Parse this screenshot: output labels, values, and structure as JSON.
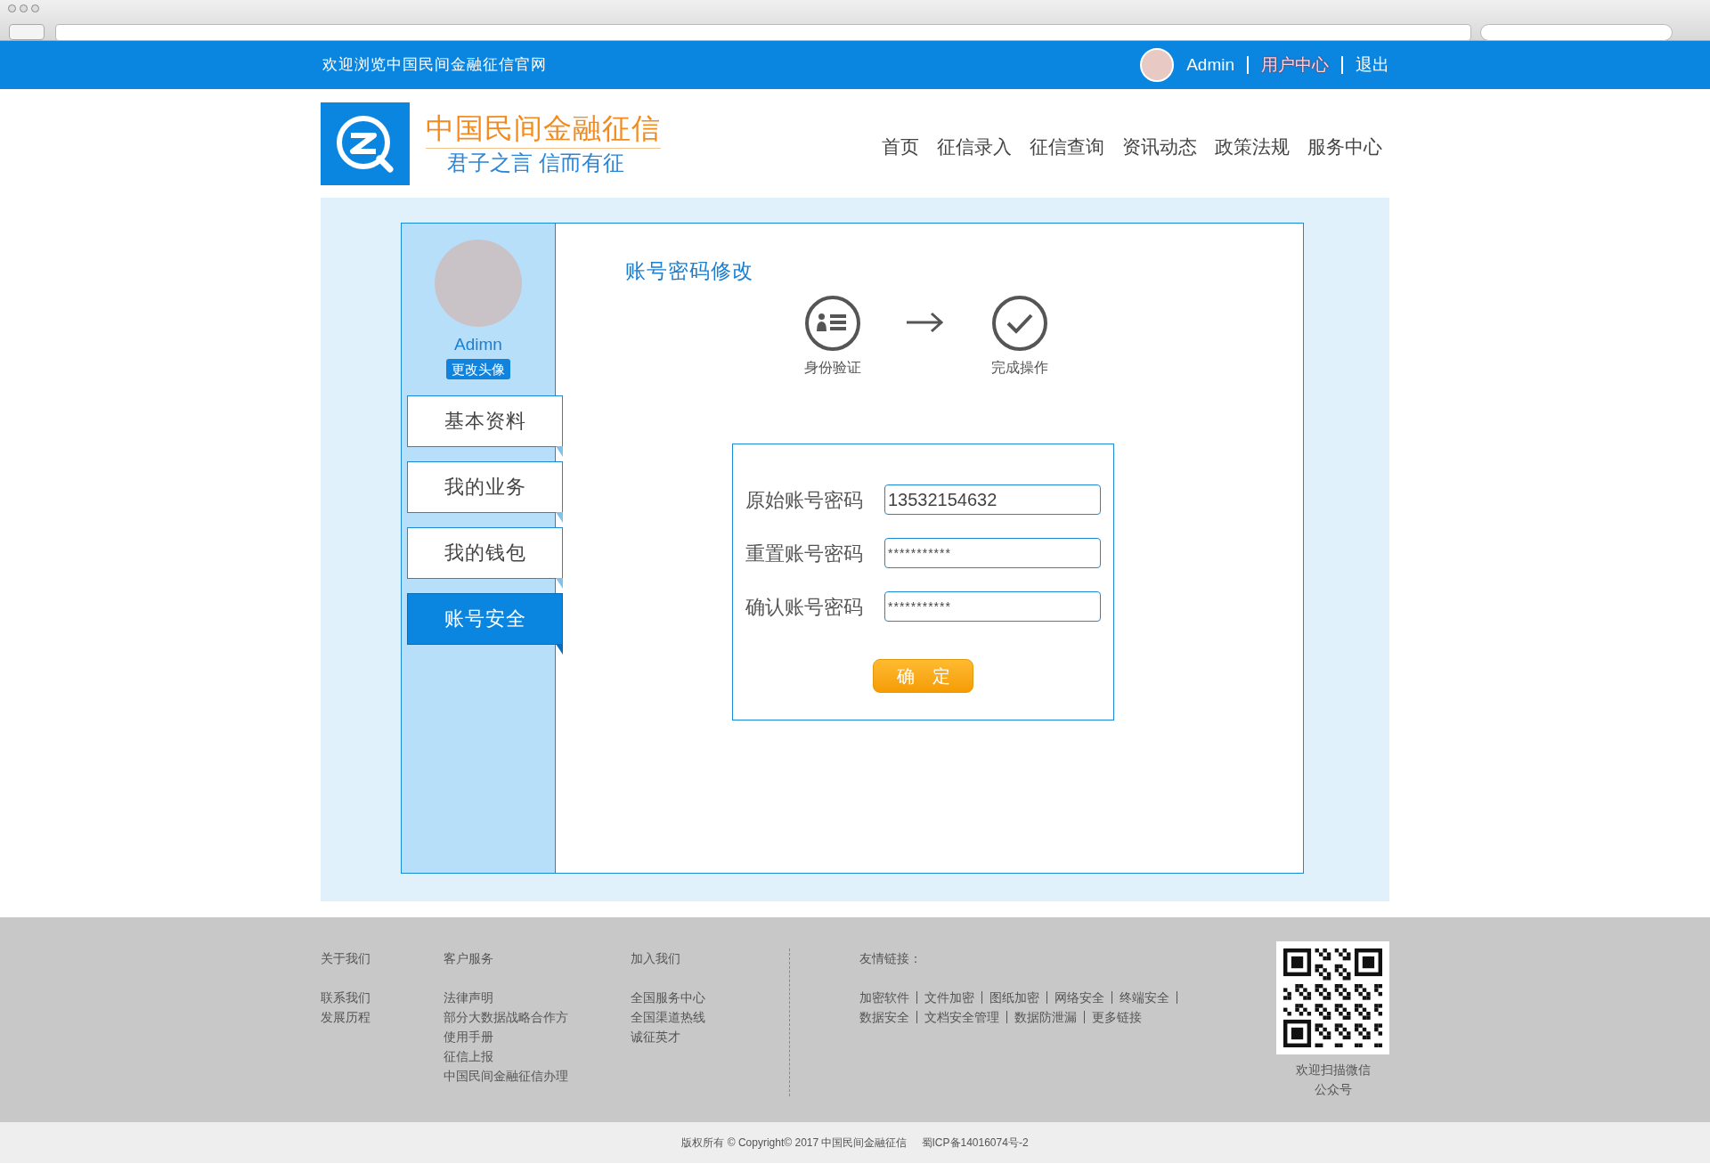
{
  "topbar": {
    "welcome": "欢迎浏览中国民间金融征信官网",
    "user": "Admin",
    "links": [
      {
        "label": "用户中心",
        "selected": true
      },
      {
        "label": "退出",
        "selected": false
      }
    ]
  },
  "header": {
    "logo_title": "中国民间金融征信",
    "logo_slogan": "君子之言 信而有征",
    "nav": [
      {
        "label": "首页"
      },
      {
        "label": "征信录入"
      },
      {
        "label": "征信查询"
      },
      {
        "label": "资讯动态"
      },
      {
        "label": "政策法规"
      },
      {
        "label": "服务中心"
      }
    ]
  },
  "sidebar": {
    "name": "Adimn",
    "change_avatar": "更改头像",
    "items": [
      {
        "label": "基本资料",
        "selected": false
      },
      {
        "label": "我的业务",
        "selected": false
      },
      {
        "label": "我的钱包",
        "selected": false
      },
      {
        "label": "账号安全",
        "selected": true
      }
    ]
  },
  "main": {
    "title": "账号密码修改",
    "steps": [
      {
        "kind": "identity",
        "label": "身份验证"
      },
      {
        "kind": "done",
        "label": "完成操作"
      }
    ],
    "fields": [
      {
        "label": "原始账号密码",
        "value": "13532154632",
        "kind": "text"
      },
      {
        "label": "重置账号密码",
        "value": "***********",
        "kind": "masked"
      },
      {
        "label": "确认账号密码",
        "value": "***********",
        "kind": "masked"
      }
    ],
    "submit": "确　定"
  },
  "footer": {
    "columns": [
      {
        "title": "关于我们",
        "links": [
          "联系我们",
          "发展历程"
        ]
      },
      {
        "title": "客户服务",
        "links": [
          "法律声明",
          "部分大数据战略合作方",
          "使用手册",
          "征信上报",
          "中国民间金融征信办理"
        ]
      },
      {
        "title": "加入我们",
        "links": [
          "全国服务中心",
          "全国渠道热线",
          "诚征英才"
        ]
      }
    ],
    "friends_title": "友情链接：",
    "friend_rows": [
      [
        "加密软件",
        "文件加密",
        "图纸加密",
        "网络安全",
        "终端安全"
      ],
      [
        "数据安全",
        "文档安全管理",
        "数据防泄漏",
        "更多链接"
      ]
    ],
    "qr_caption": [
      "欢迎扫描微信",
      "公众号"
    ],
    "copyright": "版权所有 © Copyright© 2017 中国民间金融征信",
    "icp": "蜀ICP备14016074号-2"
  }
}
